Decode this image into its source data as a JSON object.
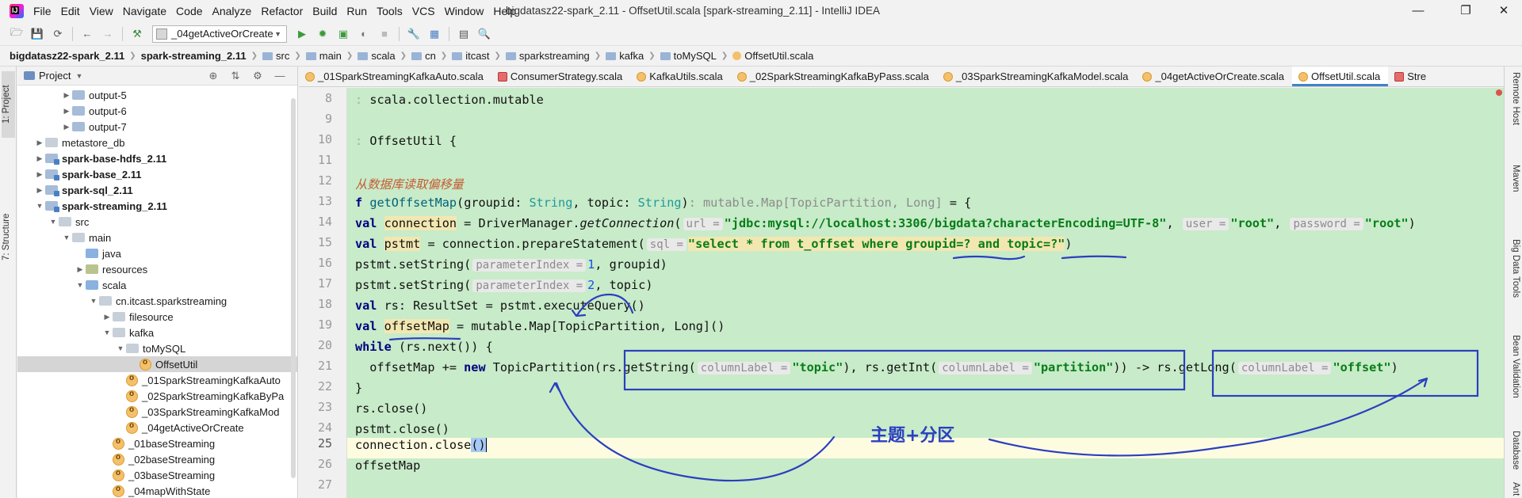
{
  "menubar": {
    "items": [
      "File",
      "Edit",
      "View",
      "Navigate",
      "Code",
      "Analyze",
      "Refactor",
      "Build",
      "Run",
      "Tools",
      "VCS",
      "Window",
      "Help"
    ],
    "window_title": "bigdatasz22-spark_2.11 - OffsetUtil.scala [spark-streaming_2.11] - IntelliJ IDEA"
  },
  "toolbar": {
    "run_config": "_04getActiveOrCreate"
  },
  "breadcrumb": [
    "bigdatasz22-spark_2.11",
    "spark-streaming_2.11",
    "src",
    "main",
    "scala",
    "cn",
    "itcast",
    "sparkstreaming",
    "kafka",
    "toMySQL",
    "OffsetUtil.scala"
  ],
  "left_stripe": {
    "project_tab": "1: Project",
    "structure_tab": "7: Structure"
  },
  "project_panel": {
    "title": "Project",
    "tree": [
      {
        "label": "output-5",
        "indent": 3,
        "twisty": "right",
        "icon": "folder",
        "bold": false
      },
      {
        "label": "output-6",
        "indent": 3,
        "twisty": "right",
        "icon": "folder",
        "bold": false
      },
      {
        "label": "output-7",
        "indent": 3,
        "twisty": "right",
        "icon": "folder",
        "bold": false
      },
      {
        "label": "metastore_db",
        "indent": 1,
        "twisty": "right",
        "icon": "folder-plain",
        "bold": false
      },
      {
        "label": "spark-base-hdfs_2.11",
        "indent": 1,
        "twisty": "right",
        "icon": "module",
        "bold": true
      },
      {
        "label": "spark-base_2.11",
        "indent": 1,
        "twisty": "right",
        "icon": "module",
        "bold": true
      },
      {
        "label": "spark-sql_2.11",
        "indent": 1,
        "twisty": "right",
        "icon": "module",
        "bold": true
      },
      {
        "label": "spark-streaming_2.11",
        "indent": 1,
        "twisty": "down",
        "icon": "module",
        "bold": true
      },
      {
        "label": "src",
        "indent": 2,
        "twisty": "down",
        "icon": "folder-plain",
        "bold": false
      },
      {
        "label": "main",
        "indent": 3,
        "twisty": "down",
        "icon": "folder-plain",
        "bold": false
      },
      {
        "label": "java",
        "indent": 4,
        "twisty": "",
        "icon": "folder-src",
        "bold": false
      },
      {
        "label": "resources",
        "indent": 4,
        "twisty": "right",
        "icon": "folder-res",
        "bold": false
      },
      {
        "label": "scala",
        "indent": 4,
        "twisty": "down",
        "icon": "folder-src",
        "bold": false
      },
      {
        "label": "cn.itcast.sparkstreaming",
        "indent": 5,
        "twisty": "down",
        "icon": "pkg",
        "bold": false
      },
      {
        "label": "filesource",
        "indent": 6,
        "twisty": "right",
        "icon": "pkg",
        "bold": false
      },
      {
        "label": "kafka",
        "indent": 6,
        "twisty": "down",
        "icon": "pkg",
        "bold": false
      },
      {
        "label": "toMySQL",
        "indent": 7,
        "twisty": "down",
        "icon": "pkg",
        "bold": false
      },
      {
        "label": "OffsetUtil",
        "indent": 8,
        "twisty": "",
        "icon": "obj",
        "bold": false,
        "selected": true
      },
      {
        "label": "_01SparkStreamingKafkaAuto",
        "indent": 7,
        "twisty": "",
        "icon": "obj",
        "bold": false
      },
      {
        "label": "_02SparkStreamingKafkaByPa",
        "indent": 7,
        "twisty": "",
        "icon": "obj",
        "bold": false
      },
      {
        "label": "_03SparkStreamingKafkaMod",
        "indent": 7,
        "twisty": "",
        "icon": "obj",
        "bold": false
      },
      {
        "label": "_04getActiveOrCreate",
        "indent": 7,
        "twisty": "",
        "icon": "obj",
        "bold": false
      },
      {
        "label": "_01baseStreaming",
        "indent": 6,
        "twisty": "",
        "icon": "obj",
        "bold": false
      },
      {
        "label": "_02baseStreaming",
        "indent": 6,
        "twisty": "",
        "icon": "obj",
        "bold": false
      },
      {
        "label": "_03baseStreaming",
        "indent": 6,
        "twisty": "",
        "icon": "obj",
        "bold": false
      },
      {
        "label": "_04mapWithState",
        "indent": 6,
        "twisty": "",
        "icon": "obj",
        "bold": false
      }
    ]
  },
  "editor_tabs": [
    {
      "label": "_01SparkStreamingKafkaAuto.scala",
      "icon": "obj",
      "active": false
    },
    {
      "label": "ConsumerStrategy.scala",
      "icon": "scala",
      "active": false
    },
    {
      "label": "KafkaUtils.scala",
      "icon": "obj",
      "active": false
    },
    {
      "label": "_02SparkStreamingKafkaByPass.scala",
      "icon": "obj",
      "active": false
    },
    {
      "label": "_03SparkStreamingKafkaModel.scala",
      "icon": "obj",
      "active": false
    },
    {
      "label": "_04getActiveOrCreate.scala",
      "icon": "obj",
      "active": false
    },
    {
      "label": "OffsetUtil.scala",
      "icon": "obj",
      "active": true
    },
    {
      "label": "Stre",
      "icon": "scala",
      "active": false
    }
  ],
  "editor": {
    "line_numbers": [
      "8",
      "9",
      "10",
      "11",
      "12",
      "13",
      "14",
      "15",
      "16",
      "17",
      "18",
      "19",
      "20",
      "21",
      "22",
      "23",
      "24",
      "25",
      "26",
      "27"
    ],
    "current_line": "25"
  },
  "code": {
    "l8": "scala.collection.mutable",
    "l10": "OffsetUtil {",
    "l12_comment": "从数据库读取偏移量",
    "l13": {
      "kw": "f",
      "name": "getOffsetMap",
      "p1": "(groupid: ",
      "t1": "String",
      "p2": ", topic: ",
      "t2": "String",
      "p3": ")",
      "ret_hint": ": mutable.Map[TopicPartition, Long]",
      "end": " = {"
    },
    "l14": {
      "kw": "val",
      "name": "connection",
      "pre": " = DriverManager.",
      "fn": "getConnection",
      "h1": "url =",
      "s1": "\"jdbc:mysql://localhost:3306/bigdata?characterEncoding=UTF-8\"",
      "h2": "user =",
      "s2": "\"root\"",
      "h3": "password =",
      "s3": "\"root\"",
      "end": ")"
    },
    "l15": {
      "kw": "val",
      "name": "pstmt",
      "pre": " = connection.prepareStatement(",
      "h1": "sql =",
      "s_a": "\"select * from t_offset where ",
      "s_b": "groupid=?",
      "s_c": " and ",
      "s_d": "topic=?",
      "s_e": "\"",
      "end": ")"
    },
    "l16": {
      "pre": "pstmt.setString(",
      "hint": "parameterIndex =",
      "num": "1",
      "end": ", groupid)"
    },
    "l17": {
      "pre": "pstmt.setString(",
      "hint": "parameterIndex =",
      "num": "2",
      "end": ", topic)"
    },
    "l18": {
      "kw": "val",
      "rest": " rs: ResultSet = pstmt.executeQuery()"
    },
    "l19": {
      "kw": "val",
      "name": "offsetMap",
      "rest": " = mutable.Map[TopicPartition, Long]()"
    },
    "l20": {
      "kw": "while",
      "rest": " (rs.next()) {"
    },
    "l21": {
      "pre": "  offsetMap += ",
      "kw": "new",
      "a": " TopicPartition(rs.getString(",
      "h1": "columnLabel =",
      "s1": "\"topic\"",
      "b": "), rs.getInt(",
      "h2": "columnLabel =",
      "s2": "\"partition\"",
      "c": ")) -> rs.getLong(",
      "h3": "columnLabel =",
      "s3": "\"offset\"",
      "d": ")"
    },
    "l22": "}",
    "l23": "rs.close()",
    "l24": "pstmt.close()",
    "l25": {
      "pre": "connection.close",
      "paren": "()"
    },
    "l26": "offsetMap"
  },
  "annotation": {
    "label": "主题+分区",
    "color": "#2b3fbf"
  },
  "right_stripe": [
    "Remote Host",
    "Maven",
    "Big Data Tools",
    "Bean Validation",
    "Database",
    "Ant"
  ]
}
